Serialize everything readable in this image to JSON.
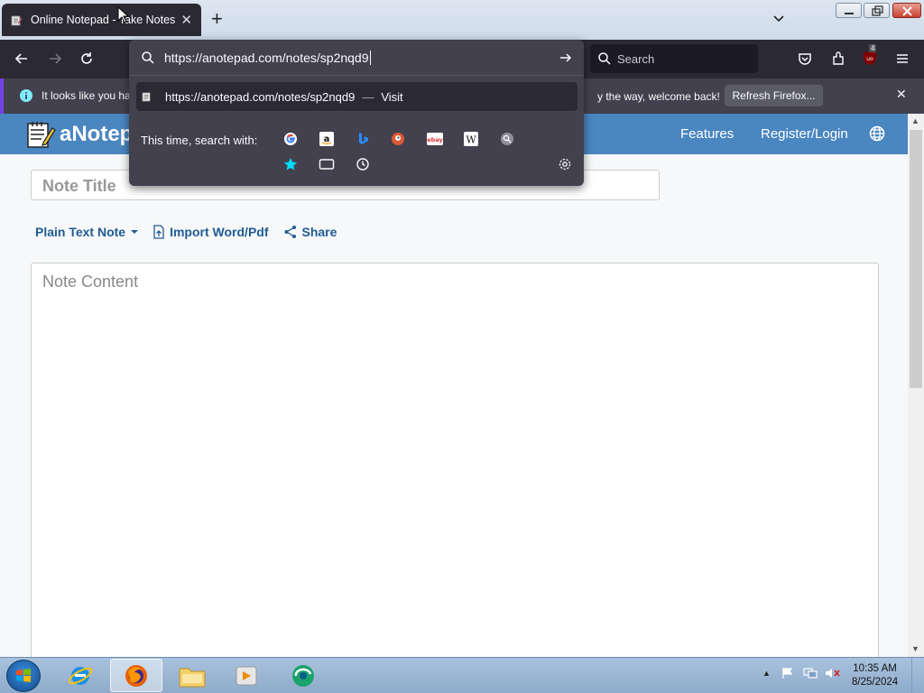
{
  "browser": {
    "tab_title": "Online Notepad - Take Notes a",
    "url": "https://anotepad.com/notes/sp2nqd9",
    "search_placeholder": "Search",
    "extension_badge": "4",
    "dropdown": {
      "suggestion_url": "https://anotepad.com/notes/sp2nqd9",
      "suggestion_sep": "—",
      "suggestion_action": "Visit",
      "search_with_label": "This time, search with:",
      "engines": [
        "Google",
        "Amazon",
        "Bing",
        "DuckDuckGo",
        "eBay",
        "Wikipedia",
        "Search"
      ],
      "modes": [
        "Bookmarks",
        "Tabs",
        "History"
      ]
    },
    "notification": {
      "left_text": "It looks like you ha",
      "right_text": "y the way, welcome back!",
      "button": "Refresh Firefox..."
    }
  },
  "site": {
    "logo": "aNotep",
    "nav": {
      "features": "Features",
      "login": "Register/Login"
    },
    "title_placeholder": "Note Title",
    "toolbar": {
      "note_type": "Plain Text Note",
      "import": "Import Word/Pdf",
      "share": "Share"
    },
    "content_placeholder": "Note Content"
  },
  "taskbar": {
    "apps": [
      "Internet Explorer",
      "Firefox",
      "File Explorer",
      "Media Player",
      "App"
    ],
    "time": "10:35 AM",
    "date": "8/25/2024"
  }
}
